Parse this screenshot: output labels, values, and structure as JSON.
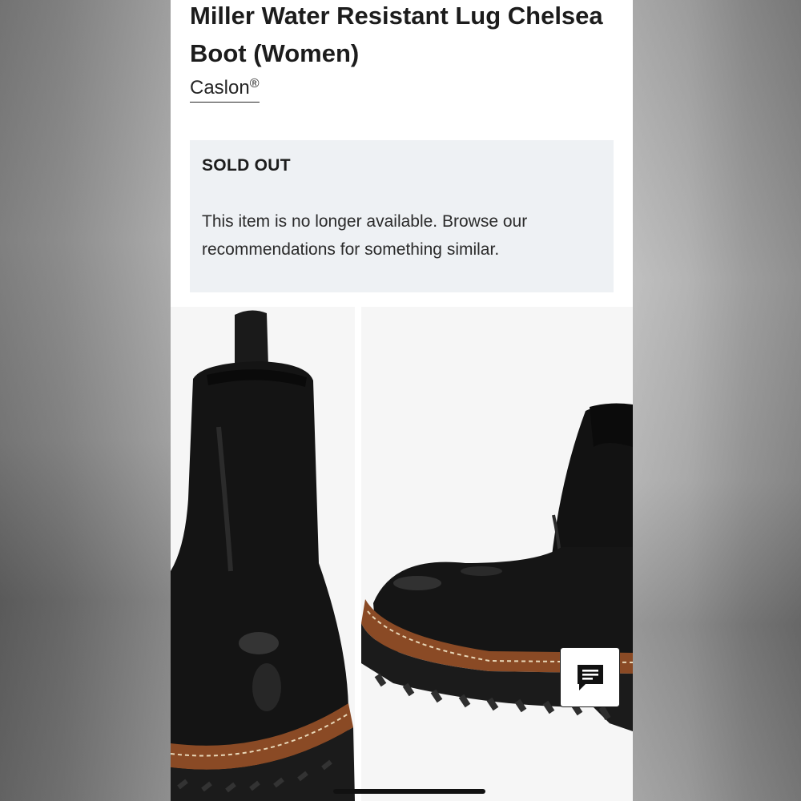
{
  "product": {
    "title": "Miller Water Resistant Lug Chelsea Boot (Women)",
    "brand": "Caslon",
    "brand_mark": "®"
  },
  "availability": {
    "status": "SOLD OUT",
    "message": "This item is no longer available. Browse our recommendations for something similar."
  },
  "gallery": {
    "images": [
      {
        "icon": "boot-rear-view-image"
      },
      {
        "icon": "boot-side-view-image"
      }
    ]
  },
  "chat": {
    "icon": "chat-icon"
  },
  "colors": {
    "page_bg": "#ffffff",
    "box_bg": "#eef1f4",
    "text": "#1c1c1c",
    "boot_leather": "#141414",
    "welt": "#8a4a25"
  }
}
